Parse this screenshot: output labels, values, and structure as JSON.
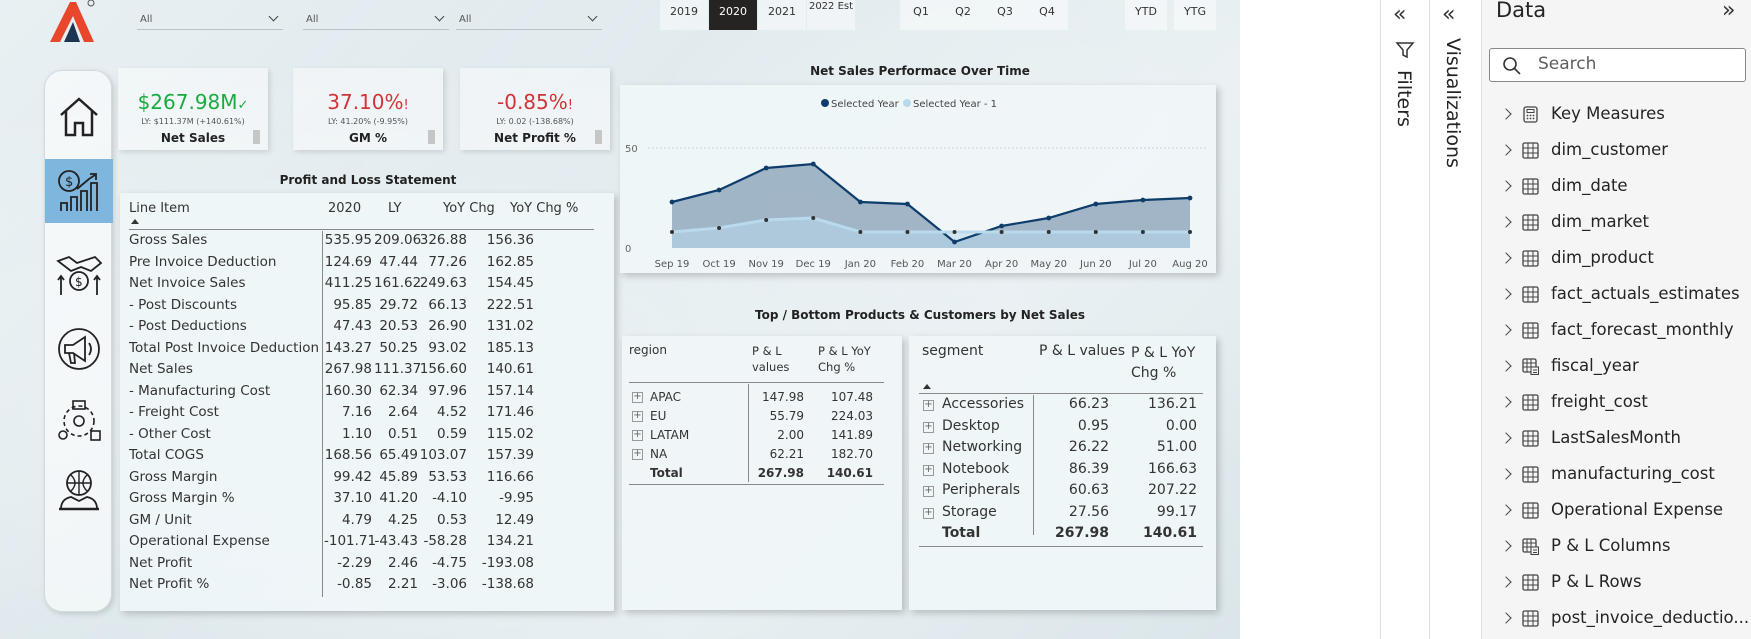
{
  "slicers": [
    {
      "value": "All"
    },
    {
      "value": "All"
    },
    {
      "value": "All"
    }
  ],
  "years": [
    "2019",
    "2020",
    "2021",
    "2022 Est"
  ],
  "selected_year": "2020",
  "quarters": [
    "Q1",
    "Q2",
    "Q3",
    "Q4"
  ],
  "period_buttons": [
    "YTD",
    "YTG"
  ],
  "kpis": [
    {
      "value": "$267.98M",
      "status_icon": "✓",
      "sub": "LY: $111.37M (+140.61%)",
      "label": "Net Sales",
      "color": "#1aab40"
    },
    {
      "value": "37.10%",
      "status_icon": "!",
      "sub": "LY: 41.20% (-9.95%)",
      "label": "GM %",
      "color": "#d13438"
    },
    {
      "value": "-0.85%",
      "status_icon": "!",
      "sub": "LY: 0.02 (-138.68%)",
      "label": "Net Profit %",
      "color": "#d13438"
    }
  ],
  "pl": {
    "title": "Profit and Loss Statement",
    "headers": [
      "Line Item",
      "2020",
      "LY",
      "YoY Chg",
      "YoY Chg %"
    ],
    "rows": [
      [
        "Gross Sales",
        "535.95",
        "209.06",
        "326.88",
        "156.36"
      ],
      [
        "Pre Invoice Deduction",
        "124.69",
        "47.44",
        "77.26",
        "162.85"
      ],
      [
        "Net Invoice Sales",
        "411.25",
        "161.62",
        "249.63",
        "154.45"
      ],
      [
        "- Post Discounts",
        "95.85",
        "29.72",
        "66.13",
        "222.51"
      ],
      [
        "- Post Deductions",
        "47.43",
        "20.53",
        "26.90",
        "131.02"
      ],
      [
        "Total Post Invoice Deduction",
        "143.27",
        "50.25",
        "93.02",
        "185.13"
      ],
      [
        "Net Sales",
        "267.98",
        "111.37",
        "156.60",
        "140.61"
      ],
      [
        "- Manufacturing Cost",
        "160.30",
        "62.34",
        "97.96",
        "157.14"
      ],
      [
        "- Freight Cost",
        "7.16",
        "2.64",
        "4.52",
        "171.46"
      ],
      [
        "- Other Cost",
        "1.10",
        "0.51",
        "0.59",
        "115.02"
      ],
      [
        "Total COGS",
        "168.56",
        "65.49",
        "103.07",
        "157.39"
      ],
      [
        "Gross Margin",
        "99.42",
        "45.89",
        "53.53",
        "116.66"
      ],
      [
        "Gross Margin %",
        "37.10",
        "41.20",
        "-4.10",
        "-9.95"
      ],
      [
        "GM / Unit",
        "4.79",
        "4.25",
        "0.53",
        "12.49"
      ],
      [
        "Operational Expense",
        "-101.71",
        "-43.43",
        "-58.28",
        "134.21"
      ],
      [
        "Net Profit",
        "-2.29",
        "2.46",
        "-4.75",
        "-193.08"
      ],
      [
        "Net Profit %",
        "-0.85",
        "2.21",
        "-3.06",
        "-138.68"
      ]
    ]
  },
  "chart_data": {
    "type": "area",
    "title": "Net Sales Performace Over Time",
    "categories": [
      "Sep 19",
      "Oct 19",
      "Nov 19",
      "Dec 19",
      "Jan 20",
      "Feb 20",
      "Mar 20",
      "Apr 20",
      "May 20",
      "Jun 20",
      "Jul 20",
      "Aug 20"
    ],
    "series": [
      {
        "name": "Selected Year",
        "values": [
          23,
          29,
          40,
          42,
          23,
          22,
          3,
          11,
          15,
          22,
          24,
          25
        ],
        "color": "#0e3d6b"
      },
      {
        "name": "Selected Year - 1",
        "values": [
          8,
          10,
          14,
          15,
          8,
          8,
          8,
          8,
          8,
          8,
          8,
          8
        ],
        "color": "#b9d9ec"
      }
    ],
    "yticks": [
      "0",
      "50"
    ],
    "ylim": [
      0,
      50
    ],
    "legend": "top-center"
  },
  "products_title": "Top / Bottom Products & Customers by Net Sales",
  "region_table": {
    "headers": [
      "region",
      "P & L values",
      "P & L YoY Chg %"
    ],
    "rows": [
      [
        "APAC",
        "147.98",
        "107.48"
      ],
      [
        "EU",
        "55.79",
        "224.03"
      ],
      [
        "LATAM",
        "2.00",
        "141.89"
      ],
      [
        "NA",
        "62.21",
        "182.70"
      ]
    ],
    "total": [
      "Total",
      "267.98",
      "140.61"
    ]
  },
  "segment_table": {
    "headers": [
      "segment",
      "P & L values",
      "P & L YoY Chg %"
    ],
    "rows": [
      [
        "Accessories",
        "66.23",
        "136.21"
      ],
      [
        "Desktop",
        "0.95",
        "0.00"
      ],
      [
        "Networking",
        "26.22",
        "51.00"
      ],
      [
        "Notebook",
        "86.39",
        "166.63"
      ],
      [
        "Peripherals",
        "60.63",
        "207.22"
      ],
      [
        "Storage",
        "27.56",
        "99.17"
      ]
    ],
    "total": [
      "Total",
      "267.98",
      "140.61"
    ]
  },
  "panes": {
    "filters_label": "Filters",
    "visualizations_label": "Visualizations",
    "data_title": "Data",
    "search_placeholder": "Search",
    "fields": [
      {
        "name": "Key Measures",
        "icon": "calculator-icon"
      },
      {
        "name": "dim_customer",
        "icon": "table-icon"
      },
      {
        "name": "dim_date",
        "icon": "table-icon"
      },
      {
        "name": "dim_market",
        "icon": "table-icon"
      },
      {
        "name": "dim_product",
        "icon": "table-icon"
      },
      {
        "name": "fact_actuals_estimates",
        "icon": "table-icon"
      },
      {
        "name": "fact_forecast_monthly",
        "icon": "table-icon"
      },
      {
        "name": "fiscal_year",
        "icon": "calc-table-icon"
      },
      {
        "name": "freight_cost",
        "icon": "table-icon"
      },
      {
        "name": "LastSalesMonth",
        "icon": "table-icon"
      },
      {
        "name": "manufacturing_cost",
        "icon": "table-icon"
      },
      {
        "name": "Operational Expense",
        "icon": "table-icon"
      },
      {
        "name": "P & L Columns",
        "icon": "calc-table-icon"
      },
      {
        "name": "P & L Rows",
        "icon": "table-icon"
      },
      {
        "name": "post_invoice_deductio...",
        "icon": "table-icon"
      }
    ]
  }
}
